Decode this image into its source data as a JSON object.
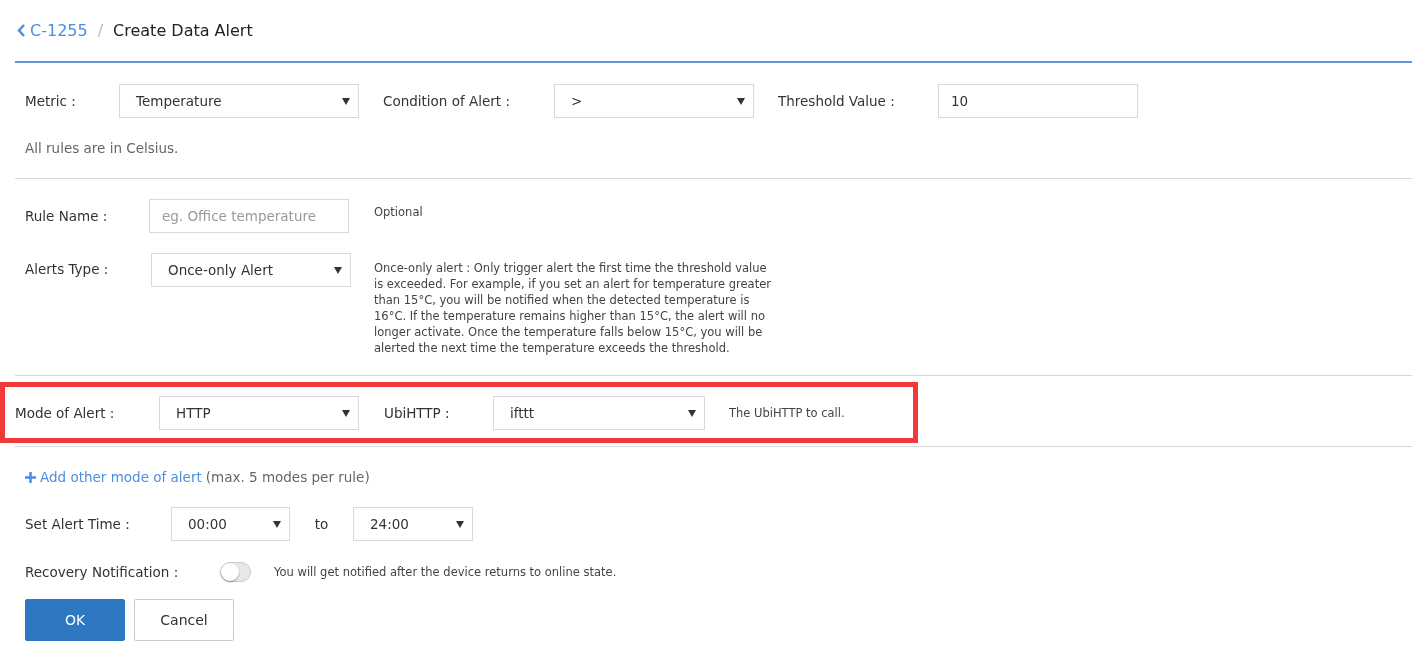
{
  "breadcrumb": {
    "back": "C-1255",
    "separator": "/",
    "title": "Create Data Alert"
  },
  "condition": {
    "metric_label": "Metric :",
    "metric": "Temperature",
    "condition_label": "Condition of Alert :",
    "condition": ">",
    "threshold_label": "Threshold Value :",
    "threshold": "10",
    "note": "All rules are in Celsius."
  },
  "rule": {
    "name_label": "Rule Name :",
    "name_placeholder": "eg. Office temperature",
    "name_hint": "Optional",
    "type_label": "Alerts Type :",
    "type": "Once-only Alert",
    "type_description": "Once-only alert : Only trigger alert the first time the threshold value is exceeded. For example, if you set an alert for temperature greater than 15°C, you will be notified when the detected temperature is 16°C. If the temperature remains higher than 15°C, the alert will no longer activate. Once the temperature falls below 15°C, you will be alerted the next time the temperature exceeds the threshold."
  },
  "mode": {
    "highlighted": true,
    "label": "Mode of Alert :",
    "mode": "HTTP",
    "target_label": "UbiHTTP :",
    "target": "ifttt",
    "hint": "The UbiHTTP to call."
  },
  "add_mode": {
    "link": "Add other mode of alert",
    "note": "(max. 5 modes per rule)"
  },
  "time": {
    "label": "Set Alert Time :",
    "from": "00:00",
    "to_label": "to",
    "to": "24:00"
  },
  "recovery": {
    "label": "Recovery Notification :",
    "on": false,
    "hint": "You will get notified after the device returns to online state."
  },
  "buttons": {
    "ok": "OK",
    "cancel": "Cancel"
  }
}
